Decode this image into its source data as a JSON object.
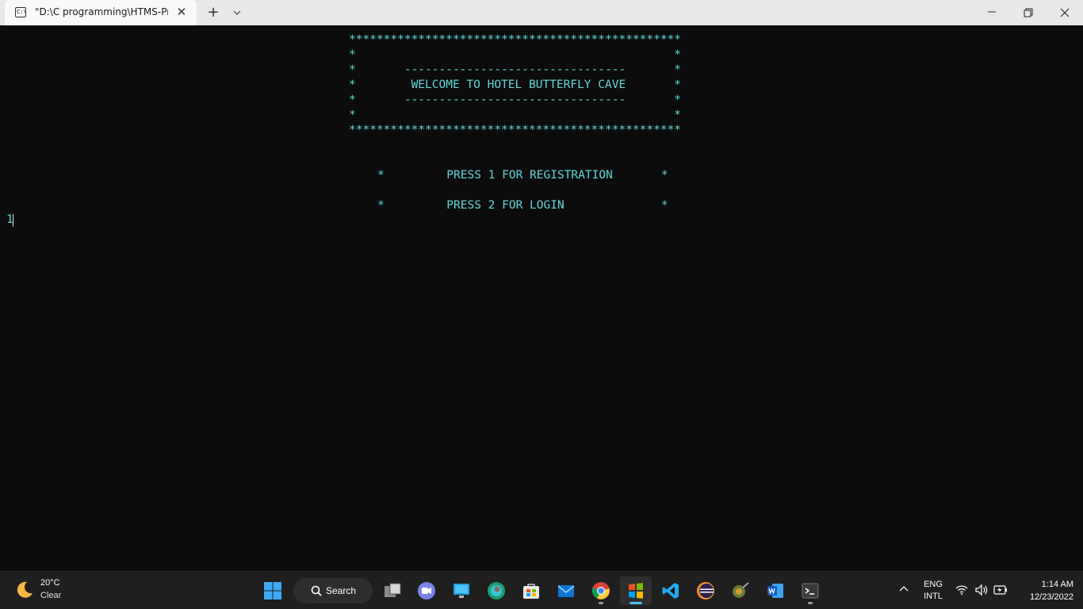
{
  "window": {
    "tab_title": "\"D:\\C programming\\HTMS-Pr",
    "tab_icon_glyph": "C:\\",
    "close_tab_glyph": "✕",
    "new_tab_glyph": "+"
  },
  "console": {
    "lines": [
      "************************************************",
      "*                                              *",
      "*       --------------------------------       *",
      "*        WELCOME TO HOTEL BUTTERFLY CAVE       *",
      "*       --------------------------------       *",
      "*                                              *",
      "************************************************"
    ],
    "menu": [
      "*         PRESS 1 FOR REGISTRATION       *",
      "*         PRESS 2 FOR LOGIN              *"
    ],
    "input": "1",
    "text_color": "#61d6d6"
  },
  "taskbar": {
    "weather": {
      "temp": "20°C",
      "condition": "Clear"
    },
    "search_label": "Search",
    "apps": [
      "start",
      "search",
      "task-view",
      "teams",
      "remote-desktop",
      "edge",
      "store",
      "mail",
      "chrome",
      "terminal-active",
      "vscode",
      "eclipse",
      "app",
      "word",
      "terminal"
    ],
    "tray": {
      "lang_line1": "ENG",
      "lang_line2": "INTL"
    },
    "clock": {
      "time": "1:14 AM",
      "date": "12/23/2022"
    }
  }
}
